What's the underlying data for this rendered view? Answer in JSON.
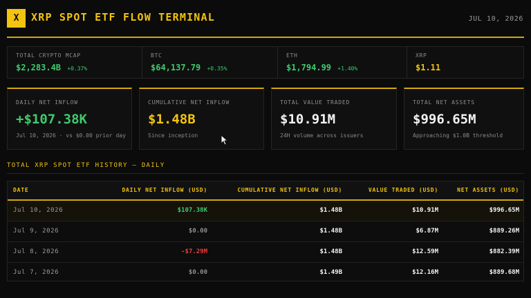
{
  "app": {
    "logo_text": "X",
    "title": "XRP SPOT ETF FLOW TERMINAL",
    "date": "JUL 10, 2026",
    "colors": {
      "accent": "#f2c40f",
      "positive": "#3fcb6d",
      "negative": "#ee3d3d",
      "background": "#0b0b0b"
    }
  },
  "ticker": [
    {
      "label": "TOTAL CRYPTO MCAP",
      "value": "$2,283.4B",
      "change": "+0.37%"
    },
    {
      "label": "BTC",
      "value": "$64,137.79",
      "change": "+0.35%"
    },
    {
      "label": "ETH",
      "value": "$1,794.99",
      "change": "+1.40%"
    },
    {
      "label": "XRP",
      "value": "$1.11",
      "change": ""
    }
  ],
  "cards": [
    {
      "label": "DAILY NET INFLOW",
      "value": "+$107.38K",
      "sub": "Jul 10, 2026 · vs $0.00 prior day"
    },
    {
      "label": "CUMULATIVE NET INFLOW",
      "value": "$1.48B",
      "sub": "Since inception"
    },
    {
      "label": "TOTAL VALUE TRADED",
      "value": "$10.91M",
      "sub": "24H volume across issuers"
    },
    {
      "label": "TOTAL NET ASSETS",
      "value": "$996.65M",
      "sub": "Approaching $1.0B threshold"
    }
  ],
  "history": {
    "title": "TOTAL XRP SPOT ETF HISTORY — DAILY",
    "columns": [
      "DATE",
      "DAILY NET INFLOW (USD)",
      "CUMULATIVE NET INFLOW (USD)",
      "VALUE TRADED (USD)",
      "NET ASSETS (USD)"
    ],
    "rows": [
      {
        "date": "Jul 10, 2026",
        "daily": "$107.38K",
        "cumulative": "$1.48B",
        "traded": "$10.91M",
        "assets": "$996.65M"
      },
      {
        "date": "Jul 9, 2026",
        "daily": "$0.00",
        "cumulative": "$1.48B",
        "traded": "$6.87M",
        "assets": "$889.26M"
      },
      {
        "date": "Jul 8, 2026",
        "daily": "-$7.29M",
        "cumulative": "$1.48B",
        "traded": "$12.59M",
        "assets": "$882.39M"
      },
      {
        "date": "Jul 7, 2026",
        "daily": "$0.00",
        "cumulative": "$1.49B",
        "traded": "$12.16M",
        "assets": "$889.68M"
      }
    ]
  },
  "cursor_icon": "mouse-pointer-icon"
}
